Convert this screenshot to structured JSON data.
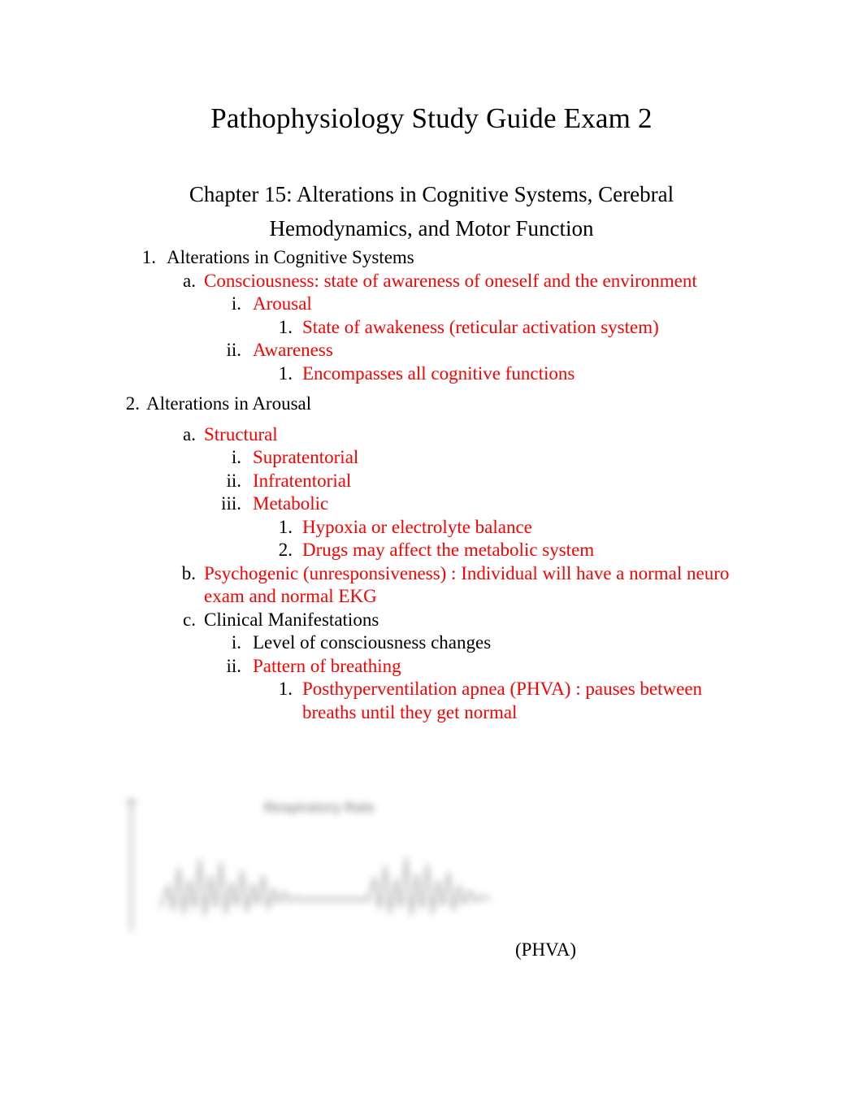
{
  "document": {
    "title": "Pathophysiology Study Guide Exam 2",
    "chapter_title": "Chapter 15: Alterations in Cognitive Systems, Cerebral Hemodynamics, and Motor Function"
  },
  "colors": {
    "highlight_red": "#FF0000",
    "body_black": "#000000",
    "page_background": "#FFFFFF"
  },
  "outline": {
    "item1": {
      "marker": "1.",
      "text": "Alterations in Cognitive Systems"
    },
    "item1a": {
      "marker": "a.",
      "text": "Consciousness: state of awareness of oneself and the environment"
    },
    "item1a_i": {
      "marker": "i.",
      "text": "Arousal"
    },
    "item1a_i_1": {
      "marker": "1.",
      "text": "State of awakeness (reticular activation system)"
    },
    "item1a_ii": {
      "marker": "ii.",
      "text": "Awareness"
    },
    "item1a_ii_1": {
      "marker": "1.",
      "text": "Encompasses all cognitive functions"
    },
    "item2": {
      "marker": "2.",
      "text": "Alterations in Arousal"
    },
    "item2a": {
      "marker": "a.",
      "text": "Structural"
    },
    "item2a_i": {
      "marker": "i.",
      "text": "Supratentorial"
    },
    "item2a_ii": {
      "marker": "ii.",
      "text": "Infratentorial"
    },
    "item2a_iii": {
      "marker": "iii.",
      "text": "Metabolic"
    },
    "item2a_iii_1": {
      "marker": "1.",
      "text": "Hypoxia or electrolyte balance"
    },
    "item2a_iii_2": {
      "marker": "2.",
      "text": "Drugs may affect the metabolic system"
    },
    "item2b": {
      "marker": "b.",
      "text": "Psychogenic (unresponsiveness) : Individual will have a normal neuro exam and normal EKG"
    },
    "item2c": {
      "marker": "c.",
      "text": "Clinical Manifestations"
    },
    "item2c_i": {
      "marker": "i.",
      "text": "Level of consciousness changes"
    },
    "item2c_ii": {
      "marker": "ii.",
      "text": "Pattern of breathing"
    },
    "item2c_ii_1": {
      "marker": "1.",
      "text": "Posthyperventilation apnea (PHVA) : pauses between breaths until they get normal"
    }
  },
  "figure": {
    "title": "Respiratory Rate",
    "caption": "(PHVA)"
  }
}
